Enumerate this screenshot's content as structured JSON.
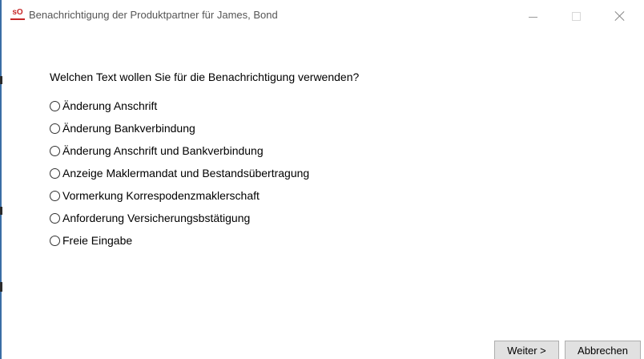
{
  "window": {
    "title": "Benachrichtigung der Produktpartner für James, Bond",
    "icon_text": "sO",
    "controls": [
      "minimize",
      "maximize",
      "close"
    ]
  },
  "dialog": {
    "prompt": "Welchen Text wollen Sie für die Benachrichtigung verwenden?",
    "options": [
      {
        "label": "Änderung Anschrift",
        "selected": false
      },
      {
        "label": "Änderung Bankverbindung",
        "selected": false
      },
      {
        "label": "Änderung Anschrift und Bankverbindung",
        "selected": false
      },
      {
        "label": "Anzeige Maklermandat und Bestandsübertragung",
        "selected": false
      },
      {
        "label": "Vormerkung Korrespodenzmaklerschaft",
        "selected": false
      },
      {
        "label": "Anforderung Versicherungsbstätigung",
        "selected": false
      },
      {
        "label": "Freie Eingabe",
        "selected": false
      }
    ]
  },
  "buttons": {
    "next_label": "Weiter >",
    "cancel_label": "Abbrechen"
  },
  "colors": {
    "accent": "#c62828",
    "button_face": "#e1e1e1",
    "button_border": "#adadad"
  }
}
